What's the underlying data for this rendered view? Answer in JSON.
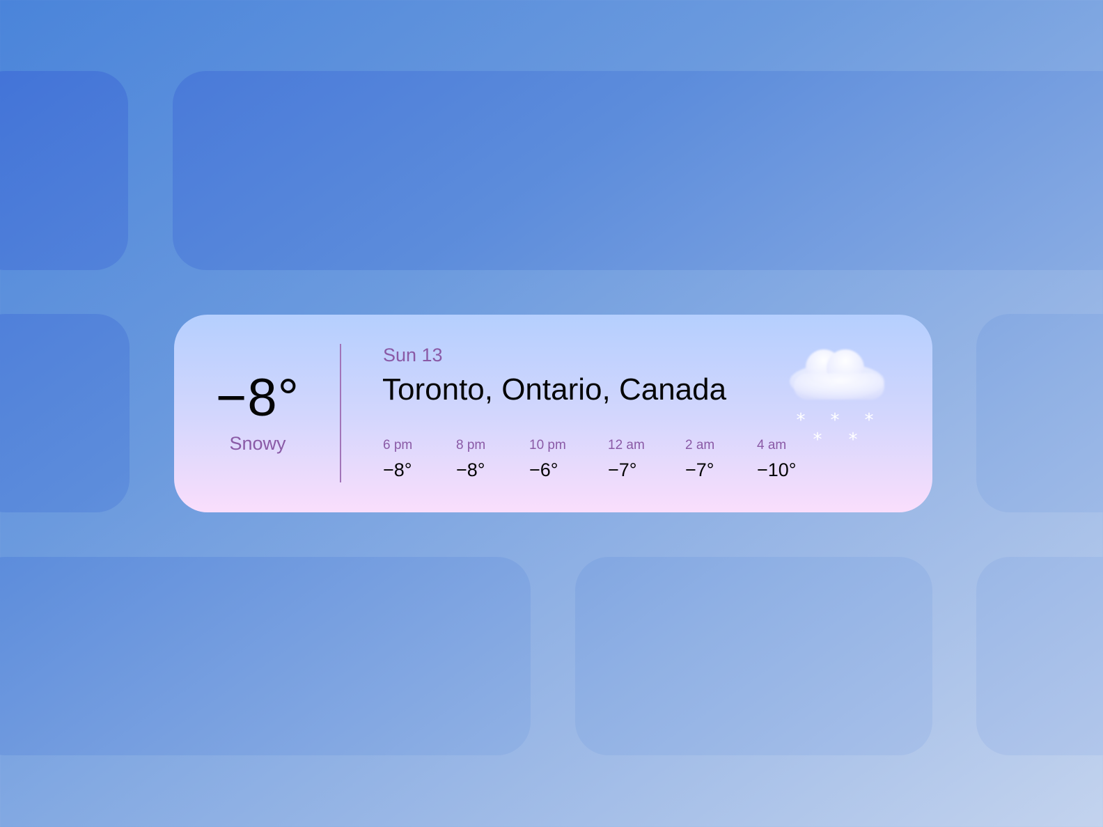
{
  "widget": {
    "current_temp": "−8°",
    "condition": "Snowy",
    "date": "Sun 13",
    "location": "Toronto, Ontario, Canada",
    "icon": "snow-cloud-icon",
    "hourly": [
      {
        "time": "6 pm",
        "temp": "−8°"
      },
      {
        "time": "8 pm",
        "temp": "−8°"
      },
      {
        "time": "10 pm",
        "temp": "−6°"
      },
      {
        "time": "12 am",
        "temp": "−7°"
      },
      {
        "time": "2 am",
        "temp": "−7°"
      },
      {
        "time": "4 am",
        "temp": "−10°"
      }
    ]
  },
  "colors": {
    "accent_text": "#8a5aa6",
    "primary_text": "#050505",
    "divider": "#a274b8"
  }
}
